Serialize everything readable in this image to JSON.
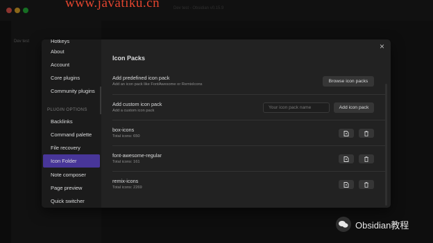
{
  "window": {
    "title": "Dev test - Obsidian v0.15.9"
  },
  "watermark": "www.javatiku.cn",
  "vault": {
    "name": "Dev test"
  },
  "settings_sidebar": {
    "top_items": [
      {
        "label": "Hotkeys"
      },
      {
        "label": "About"
      },
      {
        "label": "Account"
      },
      {
        "label": "Core plugins"
      },
      {
        "label": "Community plugins"
      }
    ],
    "plugin_options_heading": "PLUGIN OPTIONS",
    "plugin_items": [
      {
        "label": "Backlinks"
      },
      {
        "label": "Command palette"
      },
      {
        "label": "File recovery"
      },
      {
        "label": "Icon Folder",
        "active": true
      },
      {
        "label": "Note composer"
      },
      {
        "label": "Page preview"
      },
      {
        "label": "Quick switcher"
      }
    ]
  },
  "icon_packs": {
    "title": "Icon Packs",
    "predefined": {
      "name": "Add predefined icon pack",
      "desc": "Add an icon pack like FontAwesome or RemixIcons",
      "button": "Browse icon packs"
    },
    "custom": {
      "name": "Add custom icon pack",
      "desc": "Add a custom icon pack",
      "input_placeholder": "Your icon pack name",
      "button": "Add icon pack"
    },
    "packs": [
      {
        "name": "box-icons",
        "total": "Total icons: 650"
      },
      {
        "name": "font-awesome-regular",
        "total": "Total icons: 161"
      },
      {
        "name": "remix-icons",
        "total": "Total icons: 2269"
      }
    ]
  },
  "branding": {
    "wechat_label": "Obsidian教程"
  },
  "colors": {
    "accent": "#483699",
    "modal_bg": "#222222",
    "sidebar_bg": "#1b1b1b",
    "watermark": "#e5452f"
  },
  "icons": {
    "close": "close-icon",
    "add_file": "file-plus-icon",
    "delete": "trash-icon",
    "wechat": "wechat-icon"
  }
}
